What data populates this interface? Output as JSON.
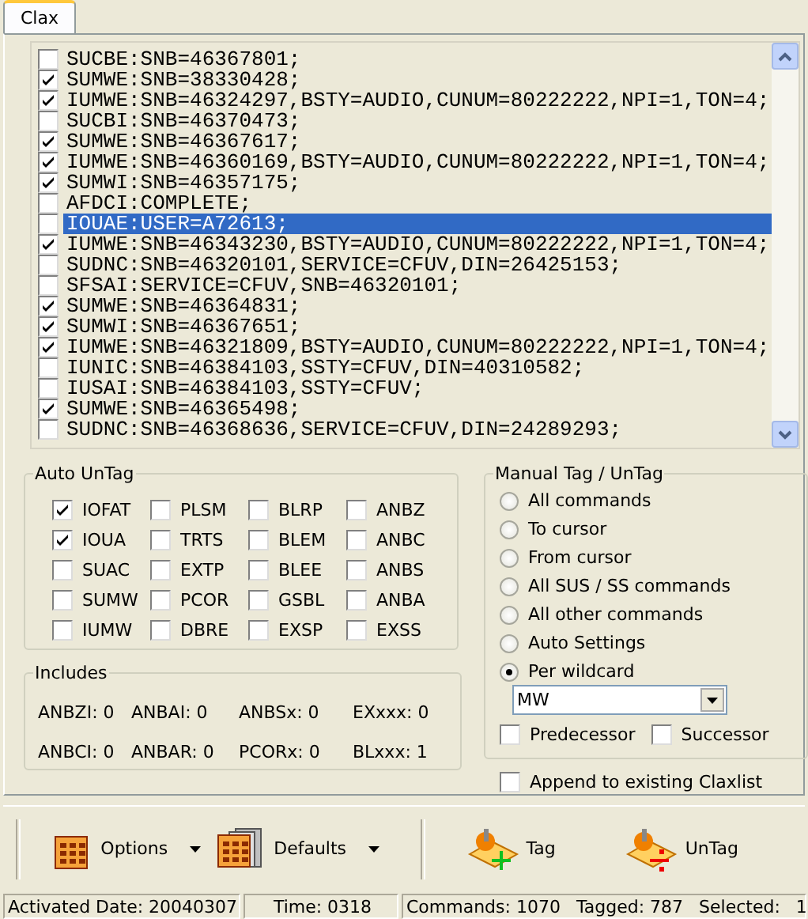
{
  "tab": {
    "label": "Clax",
    "selected": true
  },
  "commands": [
    {
      "text": "SUCBE:SNB=46367801;",
      "checked": false,
      "selected": false
    },
    {
      "text": "SUMWE:SNB=38330428;",
      "checked": true,
      "selected": false
    },
    {
      "text": "IUMWE:SNB=46324297,BSTY=AUDIO,CUNUM=80222222,NPI=1,TON=4;",
      "checked": true,
      "selected": false
    },
    {
      "text": "SUCBI:SNB=46370473;",
      "checked": false,
      "selected": false
    },
    {
      "text": "SUMWE:SNB=46367617;",
      "checked": true,
      "selected": false
    },
    {
      "text": "IUMWE:SNB=46360169,BSTY=AUDIO,CUNUM=80222222,NPI=1,TON=4;",
      "checked": true,
      "selected": false
    },
    {
      "text": "SUMWI:SNB=46357175;",
      "checked": true,
      "selected": false
    },
    {
      "text": "AFDCI:COMPLETE;",
      "checked": false,
      "selected": false
    },
    {
      "text": "IOUAE:USER=A72613;",
      "checked": false,
      "selected": true
    },
    {
      "text": "IUMWE:SNB=46343230,BSTY=AUDIO,CUNUM=80222222,NPI=1,TON=4;",
      "checked": true,
      "selected": false
    },
    {
      "text": "SUDNC:SNB=46320101,SERVICE=CFUV,DIN=26425153;",
      "checked": false,
      "selected": false
    },
    {
      "text": "SFSAI:SERVICE=CFUV,SNB=46320101;",
      "checked": false,
      "selected": false
    },
    {
      "text": "SUMWE:SNB=46364831;",
      "checked": true,
      "selected": false
    },
    {
      "text": "SUMWI:SNB=46367651;",
      "checked": true,
      "selected": false
    },
    {
      "text": "IUMWE:SNB=46321809,BSTY=AUDIO,CUNUM=80222222,NPI=1,TON=4;",
      "checked": true,
      "selected": false
    },
    {
      "text": "IUNIC:SNB=46384103,SSTY=CFUV,DIN=40310582;",
      "checked": false,
      "selected": false
    },
    {
      "text": "IUSAI:SNB=46384103,SSTY=CFUV;",
      "checked": false,
      "selected": false
    },
    {
      "text": "SUMWE:SNB=46365498;",
      "checked": true,
      "selected": false
    },
    {
      "text": "SUDNC:SNB=46368636,SERVICE=CFUV,DIN=24289293;",
      "checked": false,
      "selected": false
    }
  ],
  "auto_untag": {
    "title": "Auto UnTag",
    "items": [
      {
        "label": "IOFAT",
        "checked": true
      },
      {
        "label": "PLSM",
        "checked": false
      },
      {
        "label": "BLRP",
        "checked": false
      },
      {
        "label": "ANBZ",
        "checked": false
      },
      {
        "label": "IOUA",
        "checked": true
      },
      {
        "label": "TRTS",
        "checked": false
      },
      {
        "label": "BLEM",
        "checked": false
      },
      {
        "label": "ANBC",
        "checked": false
      },
      {
        "label": "SUAC",
        "checked": false
      },
      {
        "label": "EXTP",
        "checked": false
      },
      {
        "label": "BLEE",
        "checked": false
      },
      {
        "label": "ANBS",
        "checked": false
      },
      {
        "label": "SUMW",
        "checked": false
      },
      {
        "label": "PCOR",
        "checked": false
      },
      {
        "label": "GSBL",
        "checked": false
      },
      {
        "label": "ANBA",
        "checked": false
      },
      {
        "label": "IUMW",
        "checked": false
      },
      {
        "label": "DBRE",
        "checked": false
      },
      {
        "label": "EXSP",
        "checked": false
      },
      {
        "label": "EXSS",
        "checked": false
      }
    ]
  },
  "includes": {
    "title": "Includes",
    "items": [
      "ANBZI: 0",
      "ANBAI: 0",
      "ANBSx: 0",
      "EXxxx: 0",
      "ANBCI: 0",
      "ANBAR: 0",
      "PCORx: 0",
      "BLxxx: 1"
    ]
  },
  "manual": {
    "title": "Manual Tag / UnTag",
    "options": [
      {
        "label": "All commands",
        "selected": false
      },
      {
        "label": "To cursor",
        "selected": false
      },
      {
        "label": "From cursor",
        "selected": false
      },
      {
        "label": "All SUS / SS commands",
        "selected": false
      },
      {
        "label": "All other commands",
        "selected": false
      },
      {
        "label": "Auto Settings",
        "selected": false
      },
      {
        "label": "Per wildcard",
        "selected": true
      }
    ],
    "wildcard": {
      "value": "MW"
    },
    "predecessor": {
      "label": "Predecessor",
      "checked": false
    },
    "successor": {
      "label": "Successor",
      "checked": false
    }
  },
  "append": {
    "label": "Append to existing Claxlist",
    "checked": false
  },
  "toolbar": [
    {
      "label": "Options",
      "kind": "grid",
      "menu": true
    },
    {
      "label": "Defaults",
      "kind": "stack",
      "menu": true
    },
    {
      "label": "Tag",
      "kind": "tag",
      "menu": false
    },
    {
      "label": "UnTag",
      "kind": "untag",
      "menu": false
    }
  ],
  "status_bar": {
    "date": "Activated Date: 20040307",
    "time": "Time: 0318",
    "counts": [
      "Commands: 1070",
      "Tagged: 787",
      "Selected:",
      "1"
    ]
  }
}
